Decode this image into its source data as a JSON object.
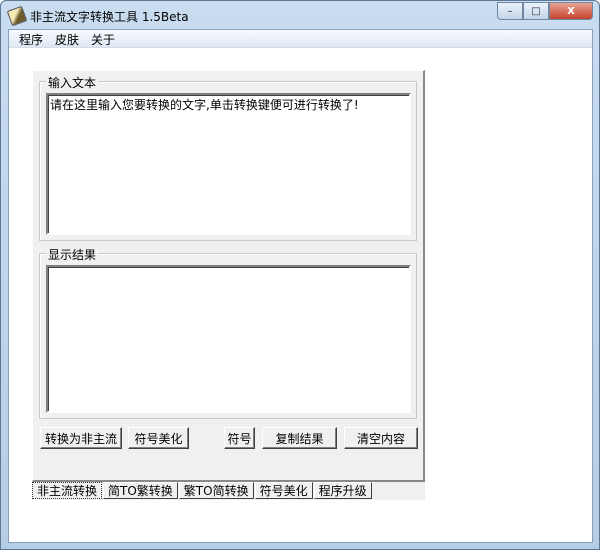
{
  "window": {
    "title": "非主流文字转换工具 1.5Beta",
    "minimize": "–",
    "maximize": "□",
    "close": "X"
  },
  "menu": [
    "程序",
    "皮肤",
    "关于"
  ],
  "input_group": {
    "label": "输入文本",
    "value": "请在这里输入您要转换的文字,单击转换键便可进行转换了!"
  },
  "result_group": {
    "label": "显示结果",
    "value": ""
  },
  "buttons": {
    "convert": "转换为非主流",
    "beautify": "符号美化",
    "symbols": "符号",
    "copy": "复制结果",
    "clear": "清空内容"
  },
  "tabs": [
    "非主流转换",
    "简TO繁转换",
    "繁TO简转换",
    "符号美化",
    "程序升级"
  ]
}
